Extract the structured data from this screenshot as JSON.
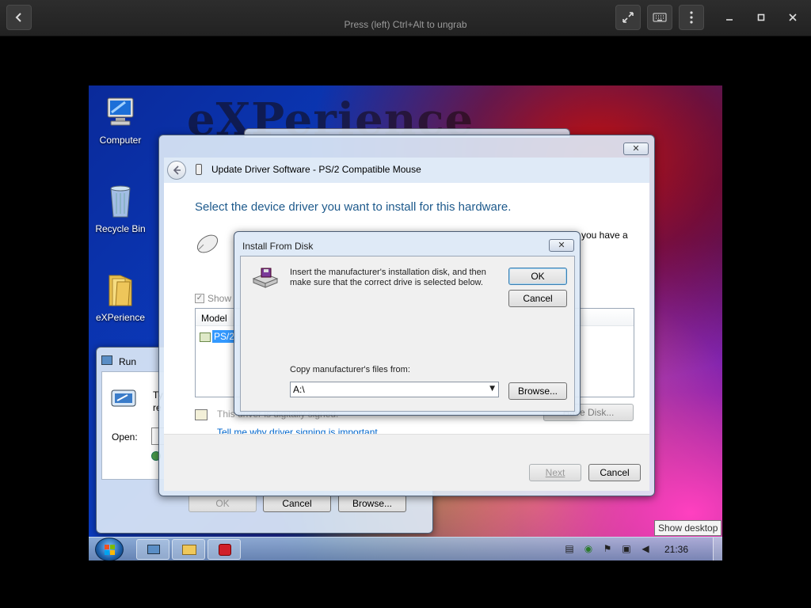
{
  "host": {
    "title": "Press (left) Ctrl+Alt to ungrab",
    "icons": {
      "back": "chevron-left-icon",
      "fullscreen": "fullscreen-icon",
      "keyboard": "keyboard-icon",
      "menu": "kebab-menu-icon",
      "minimize": "minimize-icon",
      "maximize": "maximize-icon",
      "close": "close-icon"
    }
  },
  "wallpaper": {
    "text": "eXPerience"
  },
  "desktop_icons": [
    {
      "label": "Computer",
      "icon": "computer-icon"
    },
    {
      "label": "Recycle Bin",
      "icon": "recycle-bin-icon"
    },
    {
      "label": "eXPerience",
      "icon": "folder-icon"
    }
  ],
  "run_dialog": {
    "title": "Run",
    "desc_fragment_1": "Ty",
    "desc_fragment_2": "re",
    "open_label": "Open:",
    "ok": "OK",
    "cancel": "Cancel",
    "browse": "Browse..."
  },
  "update_driver": {
    "title": "Update Driver Software - PS/2 Compatible Mouse",
    "heading": "Select the device driver you want to install for this hardware.",
    "desc_fragment": "you have a",
    "show_compatible": "Show",
    "model_header": "Model",
    "model_item": "PS/2",
    "signed_text": "This driver is digitally signed.",
    "signing_link": "Tell me why driver signing is important",
    "have_disk": "Have Disk...",
    "next": "Next",
    "cancel": "Cancel"
  },
  "install_from_disk": {
    "title": "Install From Disk",
    "message_line1": "Insert the manufacturer's installation disk, and then",
    "message_line2": "make sure that the correct drive is selected below.",
    "ok": "OK",
    "cancel": "Cancel",
    "copy_label": "Copy manufacturer's files from:",
    "path_value": "A:\\",
    "browse": "Browse..."
  },
  "taskbar": {
    "clock": "21:36",
    "show_desktop_tooltip": "Show desktop",
    "pinned": [
      "run-icon",
      "explorer-icon",
      "media-icon"
    ]
  },
  "colors": {
    "heading_blue": "#1e5a8c",
    "link": "#0066cc",
    "selection": "#3399ff"
  }
}
